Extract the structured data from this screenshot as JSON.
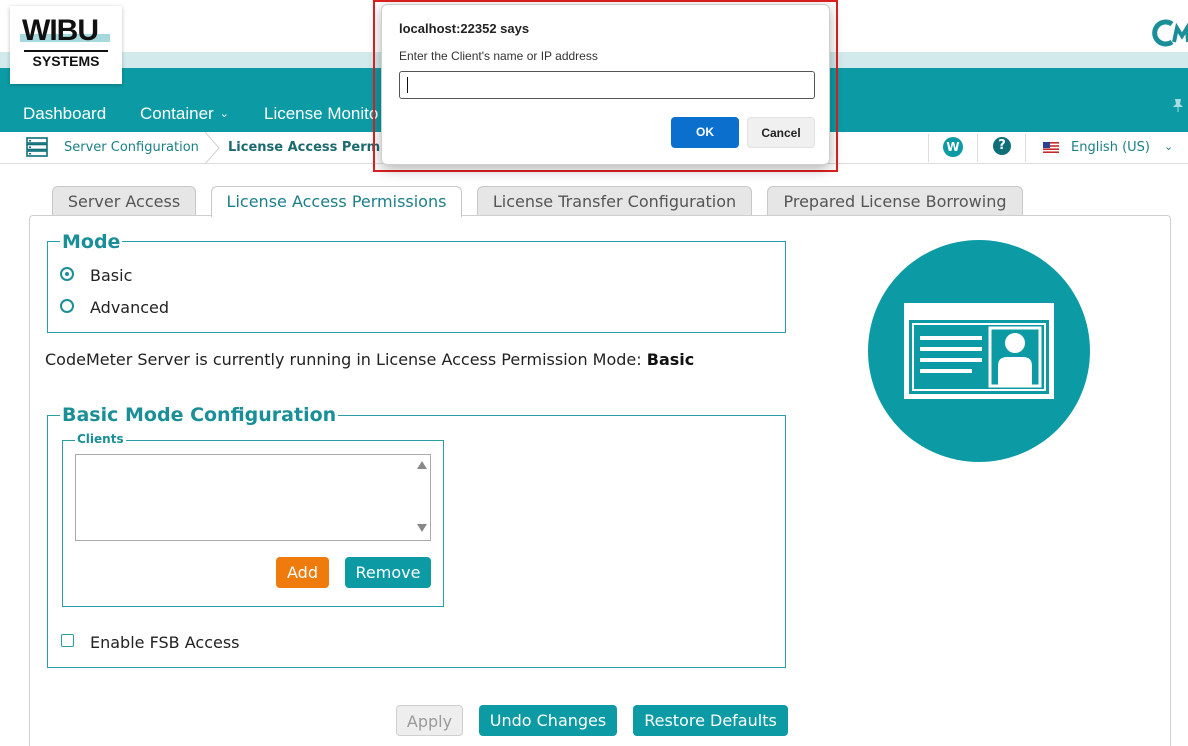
{
  "header": {
    "logo_top": "WIBU",
    "logo_bottom": "SYSTEMS",
    "nav": [
      {
        "label": "Dashboard"
      },
      {
        "label": "Container"
      },
      {
        "label": "License Monito"
      }
    ],
    "accent": "#0c9ba5"
  },
  "breadcrumb": {
    "items": [
      "Server Configuration",
      "License Access Permi"
    ],
    "w_badge": "W",
    "help": "?",
    "language": "English (US)"
  },
  "tabs": [
    {
      "label": "Server Access",
      "active": false
    },
    {
      "label": "License Access Permissions",
      "active": true
    },
    {
      "label": "License Transfer Configuration",
      "active": false
    },
    {
      "label": "Prepared License Borrowing",
      "active": false
    }
  ],
  "mode": {
    "legend": "Mode",
    "options": [
      {
        "label": "Basic",
        "selected": true
      },
      {
        "label": "Advanced",
        "selected": false
      }
    ]
  },
  "status": {
    "text": "CodeMeter Server is currently running in License Access Permission Mode:",
    "value": "Basic"
  },
  "basic_config": {
    "legend": "Basic Mode Configuration",
    "clients_legend": "Clients",
    "add_label": "Add",
    "remove_label": "Remove",
    "fsb_label": "Enable FSB Access",
    "fsb_checked": false
  },
  "actions": {
    "apply": "Apply",
    "undo": "Undo Changes",
    "restore": "Restore Defaults"
  },
  "dialog": {
    "title": "localhost:22352 says",
    "message": "Enter the Client's name or IP address",
    "input_value": "",
    "ok": "OK",
    "cancel": "Cancel",
    "ok_color": "#0b6fce",
    "highlight_color": "#e02020"
  }
}
